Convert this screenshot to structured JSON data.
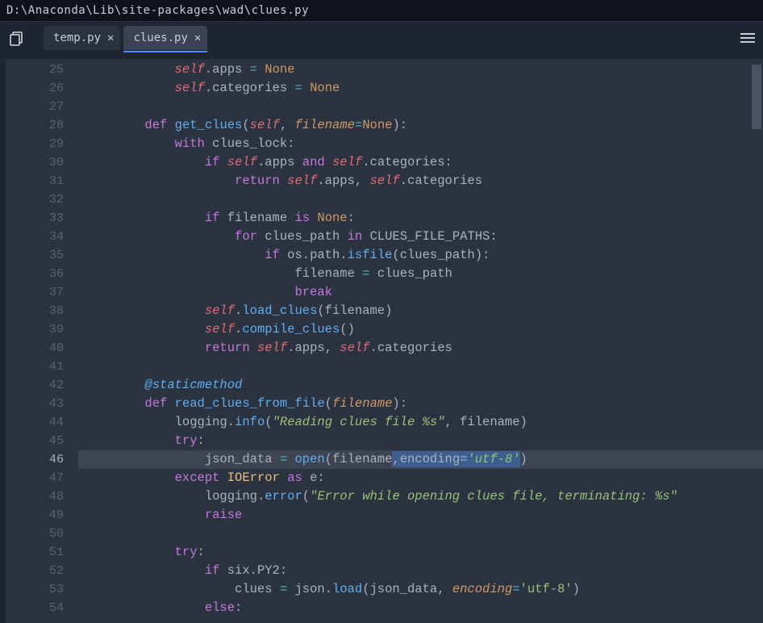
{
  "titlebar": {
    "path": "D:\\Anaconda\\Lib\\site-packages\\wad\\clues.py"
  },
  "tabs": [
    {
      "label": "temp.py",
      "active": false
    },
    {
      "label": "clues.py",
      "active": true
    }
  ],
  "gutter": {
    "start": 25,
    "end": 54,
    "current": 46
  },
  "code": {
    "l25": {
      "pre": "            ",
      "self": "self",
      "rest1": ".apps ",
      "op": "=",
      "rest2": " ",
      "none": "None"
    },
    "l26": {
      "pre": "            ",
      "self": "self",
      "rest1": ".categories ",
      "op": "=",
      "rest2": " ",
      "none": "None"
    },
    "l28": {
      "pre": "        ",
      "def": "def",
      "sp": " ",
      "fn": "get_clues",
      "p1": "(",
      "self": "self",
      "c1": ", ",
      "param": "filename",
      "eq": "=",
      "none": "None",
      "p2": "):"
    },
    "l29": {
      "pre": "            ",
      "with": "with",
      "sp": " ",
      "id": "clues_lock",
      "col": ":"
    },
    "l30": {
      "pre": "                ",
      "if": "if",
      "sp": " ",
      "self1": "self",
      "d1": ".apps ",
      "and": "and",
      "sp2": " ",
      "self2": "self",
      "d2": ".categories:"
    },
    "l31": {
      "pre": "                    ",
      "ret": "return",
      "sp": " ",
      "self1": "self",
      "d1": ".apps, ",
      "self2": "self",
      "d2": ".categories"
    },
    "l33": {
      "pre": "                ",
      "if": "if",
      "sp": " ",
      "id": "filename ",
      "is": "is",
      "sp2": " ",
      "none": "None",
      "col": ":"
    },
    "l34": {
      "pre": "                    ",
      "for": "for",
      "sp": " ",
      "id": "clues_path ",
      "in": "in",
      "sp2": " ",
      "var": "CLUES_FILE_PATHS",
      "col": ":"
    },
    "l35": {
      "pre": "                        ",
      "if": "if",
      "sp": " ",
      "id": "os.path.",
      "fn": "isfile",
      "rest": "(clues_path):"
    },
    "l36": {
      "pre": "                            ",
      "txt": "filename ",
      "op": "=",
      "rest": " clues_path"
    },
    "l37": {
      "pre": "                            ",
      "break": "break"
    },
    "l38": {
      "pre": "                ",
      "self": "self",
      "d": ".",
      "fn": "load_clues",
      "rest": "(filename)"
    },
    "l39": {
      "pre": "                ",
      "self": "self",
      "d": ".",
      "fn": "compile_clues",
      "rest": "()"
    },
    "l40": {
      "pre": "                ",
      "ret": "return",
      "sp": " ",
      "self1": "self",
      "d1": ".apps, ",
      "self2": "self",
      "d2": ".categories"
    },
    "l42": {
      "pre": "        ",
      "deco": "@staticmethod"
    },
    "l43": {
      "pre": "        ",
      "def": "def",
      "sp": " ",
      "fn": "read_clues_from_file",
      "p1": "(",
      "param": "filename",
      "p2": "):"
    },
    "l44": {
      "pre": "            ",
      "id": "logging.",
      "fn": "info",
      "p1": "(",
      "str": "\"Reading clues file %s\"",
      "rest": ", filename)"
    },
    "l45": {
      "pre": "            ",
      "try": "try",
      "col": ":"
    },
    "l46": {
      "pre": "                ",
      "id": "json_data ",
      "op": "=",
      "sp": " ",
      "fn": "open",
      "p1": "(filename",
      "sel": ",encoding=",
      "selstr": "'utf-8'",
      "p2": ")"
    },
    "l47": {
      "pre": "            ",
      "exc": "except",
      "sp": " ",
      "cls": "IOError",
      "sp2": " ",
      "as": "as",
      "sp3": " ",
      "id": "e:"
    },
    "l48": {
      "pre": "                ",
      "id": "logging.",
      "fn": "error",
      "p1": "(",
      "str": "\"Error while opening clues file, terminating: %s\""
    },
    "l49": {
      "pre": "                ",
      "raise": "raise"
    },
    "l51": {
      "pre": "            ",
      "try": "try",
      "col": ":"
    },
    "l52": {
      "pre": "                ",
      "if": "if",
      "sp": " ",
      "id": "six.PY2:"
    },
    "l53": {
      "pre": "                    ",
      "id": "clues ",
      "op": "=",
      "sp": " json.",
      "fn": "load",
      "p1": "(json_data, ",
      "param": "encoding",
      "eq": "=",
      "str": "'utf-8'",
      "p2": ")"
    },
    "l54": {
      "pre": "                ",
      "else": "else",
      "col": ":"
    }
  }
}
